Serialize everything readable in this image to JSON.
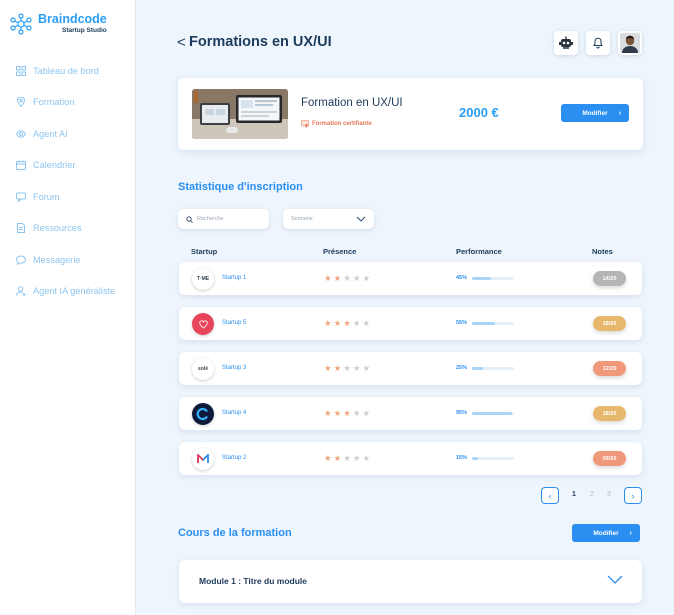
{
  "brand": {
    "name": "Braindcode",
    "subtitle": "Startup Studio"
  },
  "sidebar": {
    "items": [
      {
        "label": "Tableau de bord",
        "icon": "grid-icon"
      },
      {
        "label": "Formation",
        "icon": "location-pin-icon"
      },
      {
        "label": "Agent AI",
        "icon": "eye-icon"
      },
      {
        "label": "Calendrier",
        "icon": "calendar-icon"
      },
      {
        "label": "Forum",
        "icon": "chat-icon"
      },
      {
        "label": "Ressources",
        "icon": "document-icon"
      },
      {
        "label": "Messagerie",
        "icon": "message-icon"
      },
      {
        "label": "Agent IA généraliste",
        "icon": "user-icon"
      }
    ]
  },
  "header": {
    "back": "<",
    "title": "Formations en UX/UI"
  },
  "course": {
    "name": "Formation en UX/UI",
    "badge": "Formation certifiante",
    "price": "2000 €",
    "edit_label": "Modifier"
  },
  "stats": {
    "title": "Statistique d'inscription",
    "search_placeholder": "Recherche",
    "period_value": "Semaine",
    "columns": [
      "Startup",
      "Présence",
      "Performance",
      "Notes"
    ],
    "rows": [
      {
        "name": "Startup 1",
        "logo": "T·ME",
        "stars": 2,
        "performance": "45%",
        "fill": 0.45,
        "note": "14/20",
        "note_color": "#b5b5b5"
      },
      {
        "name": "Startup 5",
        "logo": "heart",
        "stars": 3,
        "performance": "55%",
        "fill": 0.55,
        "note": "18/20",
        "note_color": "#e8b76e"
      },
      {
        "name": "Startup 3",
        "logo": "solé",
        "stars": 2,
        "performance": "25%",
        "fill": 0.25,
        "note": "12/20",
        "note_color": "#f0987a"
      },
      {
        "name": "Startup 4",
        "logo": "circle",
        "stars": 3,
        "performance": "95%",
        "fill": 0.95,
        "note": "18/20",
        "note_color": "#e8b76e"
      },
      {
        "name": "Startup 2",
        "logo": "M",
        "stars": 2,
        "performance": "15%",
        "fill": 0.15,
        "note": "09/20",
        "note_color": "#f0987a"
      }
    ],
    "pagination": {
      "prev": "‹",
      "next": "›",
      "pages": [
        "1",
        "2",
        "3"
      ],
      "current": "1"
    }
  },
  "courses": {
    "title": "Cours de la formation",
    "edit_label": "Modifier",
    "modules": [
      {
        "title": "Module 1 : Titre du module"
      }
    ]
  },
  "colors": {
    "accent": "#2a8ff0",
    "dark": "#1d3b5c",
    "background": "#eef5fc"
  }
}
